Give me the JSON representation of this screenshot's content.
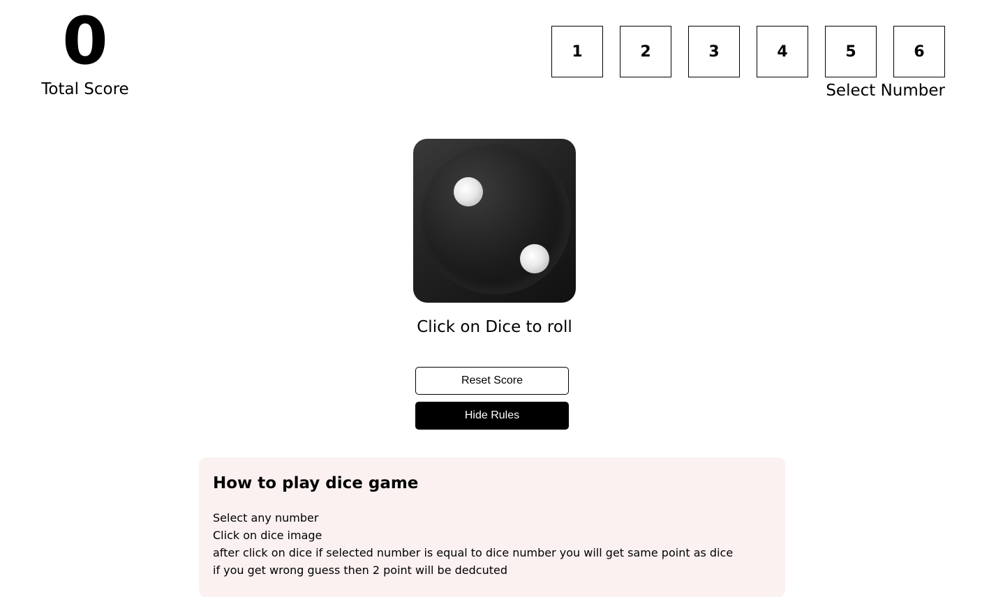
{
  "score": {
    "value": "0",
    "label": "Total Score"
  },
  "selector": {
    "numbers": [
      "1",
      "2",
      "3",
      "4",
      "5",
      "6"
    ],
    "label": "Select Number"
  },
  "dice": {
    "current_face": 2,
    "hint": "Click on Dice to roll"
  },
  "buttons": {
    "reset": "Reset Score",
    "rules_toggle": "Hide Rules"
  },
  "rules": {
    "title": "How to play dice game",
    "lines": [
      "Select any number",
      "Click on dice image",
      "after click on dice if selected number is equal to dice number you will get same point as dice",
      "if you get wrong guess then 2 point will be dedcuted"
    ]
  }
}
